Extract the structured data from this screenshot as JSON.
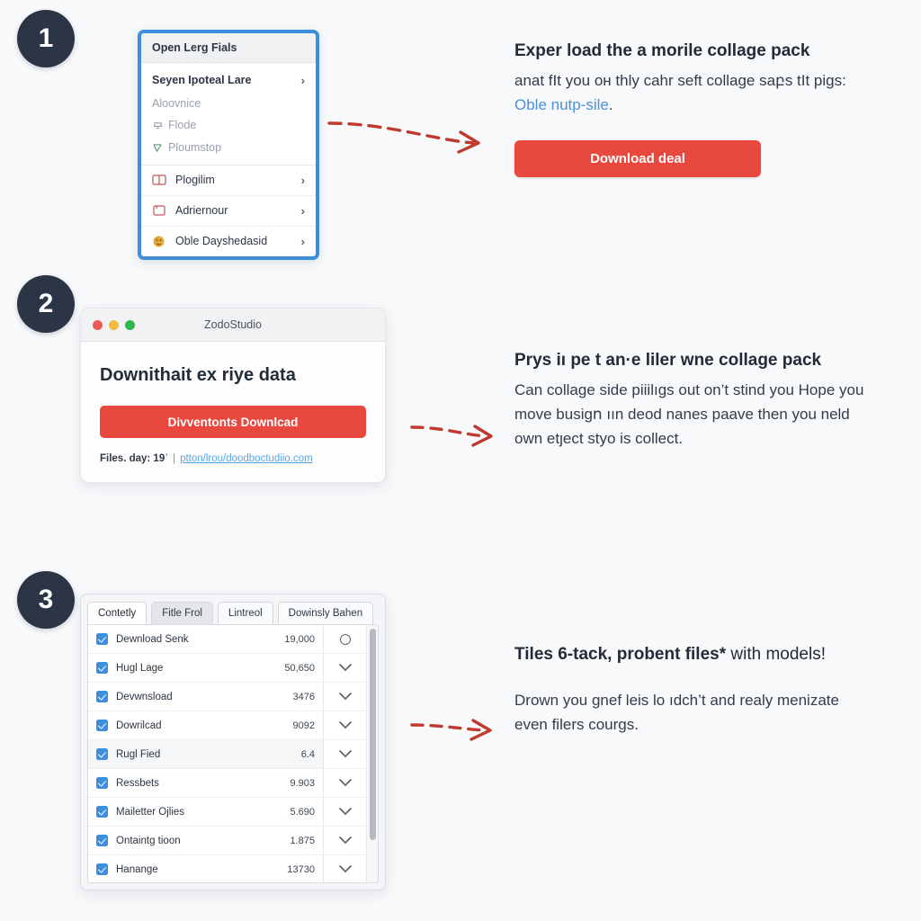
{
  "background_color": "#f8f9fb",
  "accent_colors": {
    "badge": "#2b3545",
    "cta_red": "#e9483f",
    "border_blue": "#3e8ede",
    "link_blue": "#4a90d9",
    "arrow_red": "#c0392f",
    "checkbox_blue": "#3e8ede"
  },
  "steps": [
    {
      "number": "1",
      "menu": {
        "header": "Open Lerg Fials",
        "group": [
          {
            "label": "Seyen Ipoteal Lare",
            "style": "primary",
            "chevron": "›"
          },
          {
            "label": "Aloovnice",
            "style": "muted"
          },
          {
            "label": "Flode",
            "style": "muted",
            "icon": "tray-icon"
          },
          {
            "label": "Ploumstop",
            "style": "muted",
            "icon": "checklist-icon"
          }
        ],
        "items": [
          {
            "label": "Plogilim",
            "icon": "book-icon",
            "chevron": "›"
          },
          {
            "label": "Adriernour",
            "icon": "book-icon",
            "chevron": "›"
          },
          {
            "label": "Oble Dayshedasid",
            "icon": "orange-circle-icon",
            "chevron": "›"
          }
        ]
      },
      "copy": {
        "heading": "Exper load the a morile collage pack",
        "body_before": "anat fIt you oн thly cahr seft collage saբѕ tIt pigs: ",
        "link": "Oble nutp-sile",
        "body_after": ".",
        "cta": "Download deal"
      }
    },
    {
      "number": "2",
      "window": {
        "title": "ZodoStudio",
        "heading": "Downithait ex riye data",
        "cta": "Divventonts Downlcad",
        "footer_meta": "Files. day: 19ˈ",
        "footer_sep": "|",
        "footer_link": "ptton/lrou/doodboctudiio.com"
      },
      "copy": {
        "heading": "Prys iı pe t an·e liler wne collage pack",
        "body": "Can collage side piiilıgs out on’t stind you Hope you move busigո ıın deod nanes paave then you neld own etȷect styo is collect."
      }
    },
    {
      "number": "3",
      "table": {
        "tabs": [
          {
            "label": "Contetly",
            "state": "active"
          },
          {
            "label": "Fitle Frol",
            "state": "hover"
          },
          {
            "label": "Lintreol",
            "state": "normal"
          },
          {
            "label": "Dowinsly Bahen",
            "state": "normal"
          }
        ],
        "columns": [
          "name",
          "value",
          "control"
        ],
        "rows": [
          {
            "checked": true,
            "label": "Dewnload Senk",
            "value": "19,000",
            "control": "circle",
            "highlight": false
          },
          {
            "checked": true,
            "label": "Hugl Lage",
            "value": "50,650",
            "control": "chevron",
            "highlight": false
          },
          {
            "checked": true,
            "label": "Devwnsload",
            "value": "3476",
            "control": "chevron",
            "highlight": false
          },
          {
            "checked": true,
            "label": "Dowrilcad",
            "value": "9092",
            "control": "chevron",
            "highlight": false
          },
          {
            "checked": true,
            "label": "Rugl Fied",
            "value": "6.4",
            "control": "chevron",
            "highlight": true
          },
          {
            "checked": true,
            "label": "Ressbets",
            "value": "9.903",
            "control": "chevron",
            "highlight": false
          },
          {
            "checked": true,
            "label": "Mailetter Ojlies",
            "value": "5.690",
            "control": "chevron",
            "highlight": false
          },
          {
            "checked": true,
            "label": "Ontaintg tioon",
            "value": "1.875",
            "control": "chevron",
            "highlight": false
          },
          {
            "checked": true,
            "label": "Hanange",
            "value": "13730",
            "control": "chevron",
            "highlight": false
          }
        ]
      },
      "copy": {
        "heading_bold": "Tiles 6-tack, probent files*",
        "heading_rest": " with models!",
        "body": "Drown you gnef leis lo ıdch’t and realy menizate even filers courgs."
      }
    }
  ]
}
